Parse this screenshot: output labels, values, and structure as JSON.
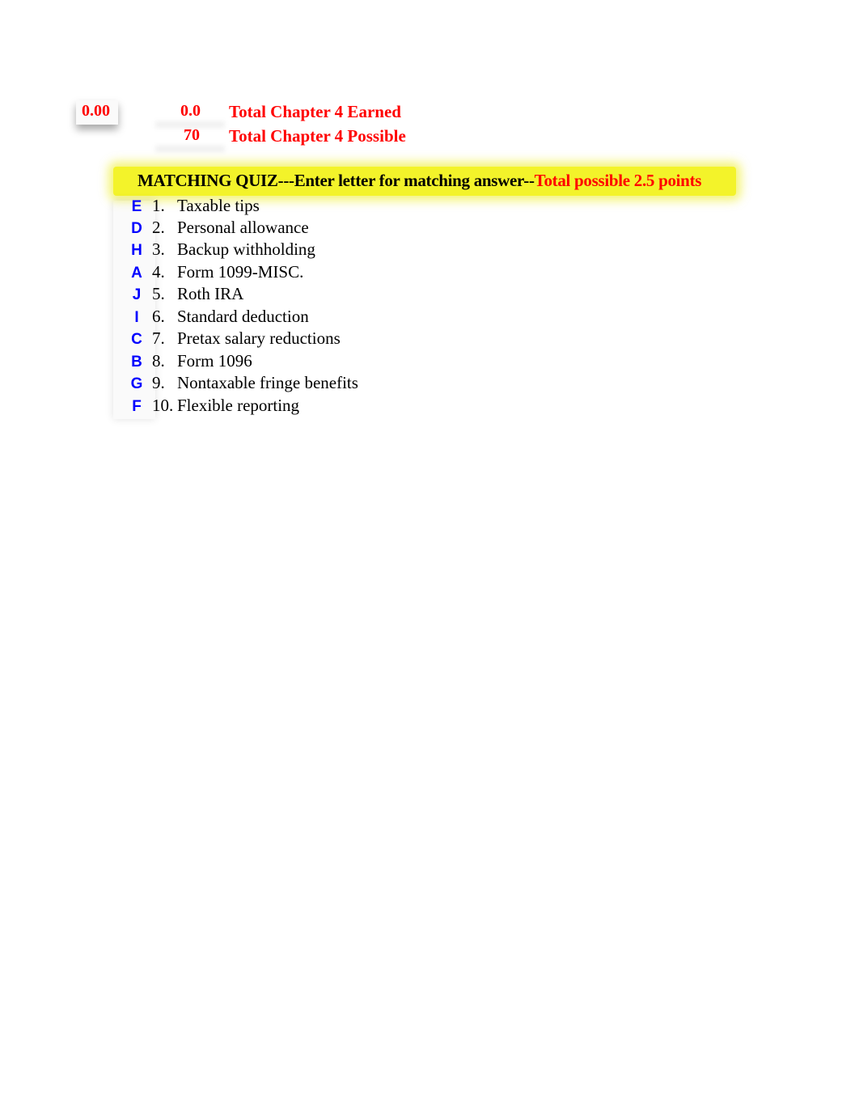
{
  "summary": {
    "score": "0.00",
    "earned_value": "0.0",
    "earned_label": "Total Chapter 4 Earned",
    "possible_value": "70",
    "possible_label": "Total Chapter 4 Possible"
  },
  "quiz": {
    "title_black": "MATCHING QUIZ---Enter letter for matching answer--",
    "title_red": "Total possible 2.5 points",
    "items": [
      {
        "answer": "E",
        "number": "1.",
        "term": "Taxable tips"
      },
      {
        "answer": "D",
        "number": "2.",
        "term": "Personal allowance"
      },
      {
        "answer": "H",
        "number": "3.",
        "term": "Backup withholding"
      },
      {
        "answer": "A",
        "number": "4.",
        "term": "Form 1099-MISC."
      },
      {
        "answer": "J",
        "number": "5.",
        "term": "Roth IRA"
      },
      {
        "answer": "I",
        "number": "6.",
        "term": "Standard deduction"
      },
      {
        "answer": "C",
        "number": "7.",
        "term": "Pretax salary reductions"
      },
      {
        "answer": "B",
        "number": "8.",
        "term": "Form 1096"
      },
      {
        "answer": "G",
        "number": "9.",
        "term": "Nontaxable fringe benefits"
      },
      {
        "answer": "F",
        "number": "10.",
        "term": "Flexible reporting"
      }
    ]
  }
}
